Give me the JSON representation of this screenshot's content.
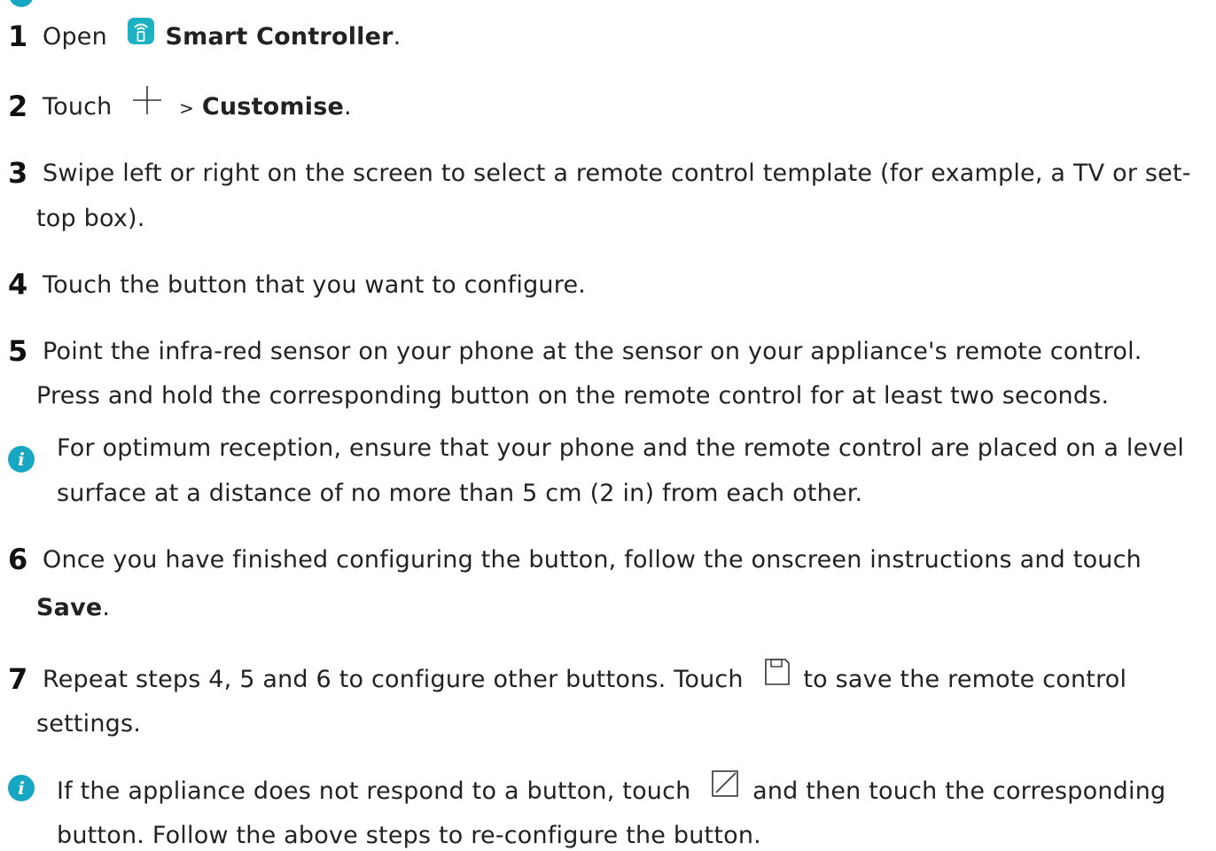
{
  "steps": [
    {
      "number": "1",
      "lines": [
        {
          "pre": "Open",
          "app_name": "Smart Controller",
          "post": "."
        }
      ]
    },
    {
      "number": "2",
      "lines": [
        {
          "pre": "Touch",
          "sep": ">",
          "bold": "Customise",
          "post": "."
        }
      ]
    },
    {
      "number": "3",
      "lines": [
        "Swipe left or right on the screen to select a remote control template (for example, a TV or set-",
        "top box)."
      ]
    },
    {
      "number": "4",
      "lines": [
        "Touch the button that you want to configure."
      ]
    },
    {
      "number": "5",
      "lines": [
        "Point the infra-red sensor on your phone at the sensor on your appliance's remote control.",
        "Press and hold the corresponding button on the remote control for at least two seconds."
      ]
    },
    {
      "number": "6",
      "lines": [
        "Once you have finished configuring the button, follow the onscreen instructions and touch",
        {
          "bold": "Save",
          "post": "."
        }
      ]
    },
    {
      "number": "7",
      "lines": [
        {
          "pre": "Repeat steps 4, 5 and 6 to configure other buttons. Touch",
          "post": "to save the remote control"
        },
        "settings."
      ]
    }
  ],
  "notes": [
    {
      "icon": "info-icon",
      "lines": [
        "For optimum reception, ensure that your phone and the remote control are placed on a level",
        "surface at a distance of no more than 5 cm (2 in) from each other."
      ]
    },
    {
      "icon": "info-icon",
      "lines": [
        {
          "pre": "If the appliance does not respond to a button, touch",
          "post": "and then touch the corresponding"
        },
        "button. Follow the above steps to re-configure the button."
      ]
    }
  ],
  "icons": {
    "app_icon": "smart-controller-app-icon",
    "add": "plus-icon",
    "save": "floppy-save-icon",
    "edit": "edit-square-icon"
  },
  "colors": {
    "text": "#222222",
    "accent": "#18a7c2"
  }
}
